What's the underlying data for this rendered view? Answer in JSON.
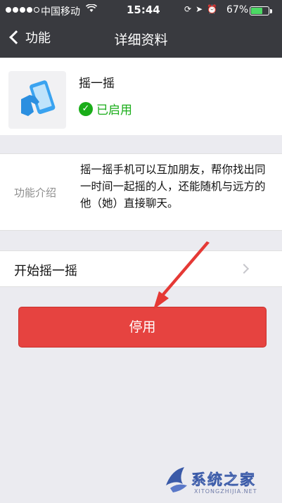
{
  "status_bar": {
    "carrier": "中国移动",
    "time": "15:44",
    "battery": "67%",
    "battery_level": 0.67
  },
  "nav": {
    "back_label": "功能",
    "title": "详细资料"
  },
  "feature": {
    "name": "摇一摇",
    "status": "已启用"
  },
  "description": {
    "label": "功能介绍",
    "text": "摇一摇手机可以互加朋友，帮你找出同一时间一起摇的人，还能随机与远方的他（她）直接聊天。"
  },
  "start_row": {
    "label": "开始摇一摇"
  },
  "disable_button": {
    "label": "停用"
  },
  "watermark": {
    "name": "系统之家",
    "url": "XITONGZHIJIA.NET"
  },
  "colors": {
    "nav_bg": "#393a3f",
    "accent_green": "#1aad19",
    "danger_red": "#e64340",
    "page_bg": "#ebebf0"
  }
}
